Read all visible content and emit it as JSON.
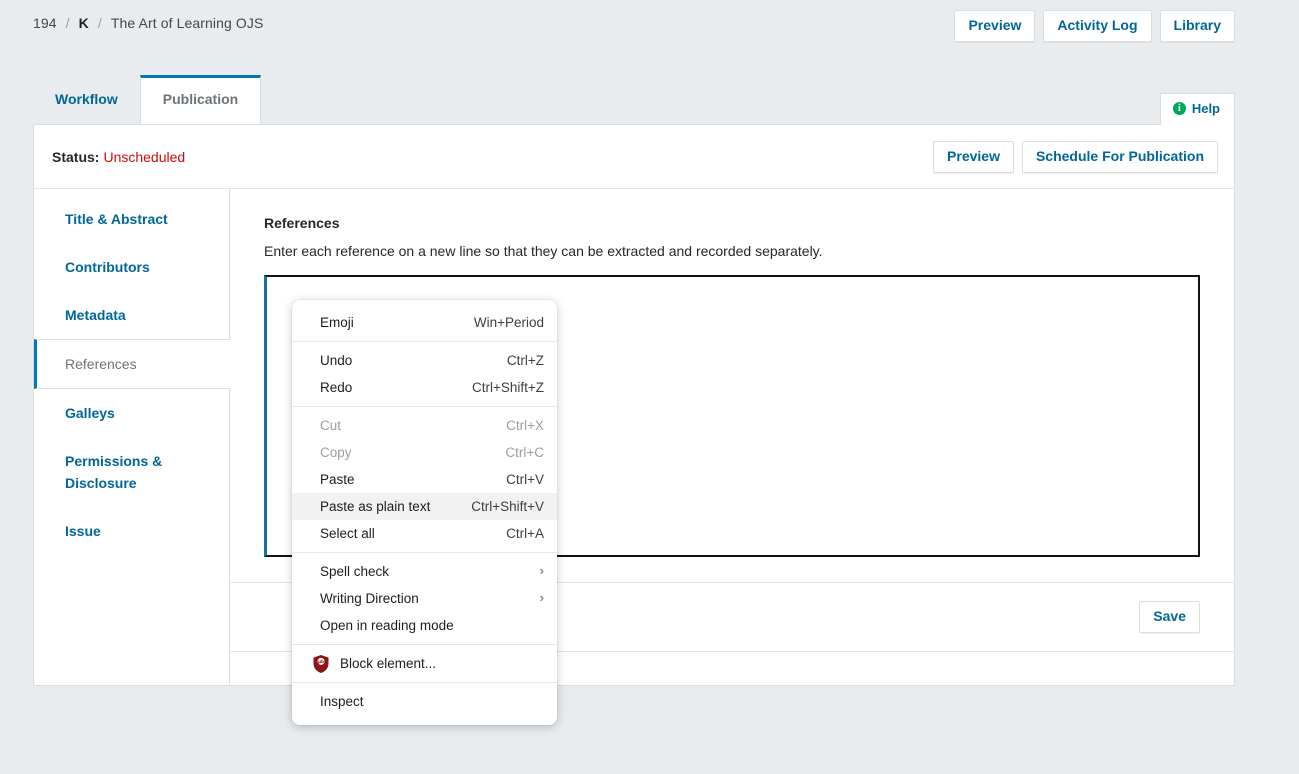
{
  "breadcrumb": {
    "items": [
      {
        "label": "194",
        "bold": false
      },
      {
        "label": "K",
        "bold": true
      },
      {
        "label": "The Art of Learning OJS",
        "bold": false
      }
    ],
    "separator": "/"
  },
  "header_buttons": [
    {
      "label": "Preview"
    },
    {
      "label": "Activity Log"
    },
    {
      "label": "Library"
    }
  ],
  "tabs": [
    {
      "label": "Workflow",
      "active": false
    },
    {
      "label": "Publication",
      "active": true
    }
  ],
  "help": {
    "label": "Help",
    "icon": "info-icon",
    "icon_glyph": "i"
  },
  "status": {
    "label": "Status:",
    "value": "Unscheduled",
    "value_color": "#d00a0a"
  },
  "status_buttons": [
    {
      "label": "Preview"
    },
    {
      "label": "Schedule For Publication"
    }
  ],
  "sidebar": {
    "items": [
      {
        "label": "Title & Abstract",
        "active": false
      },
      {
        "label": "Contributors",
        "active": false
      },
      {
        "label": "Metadata",
        "active": false
      },
      {
        "label": "References",
        "active": true
      },
      {
        "label": "Galleys",
        "active": false
      },
      {
        "label": "Permissions & Disclosure",
        "active": false
      },
      {
        "label": "Issue",
        "active": false
      }
    ],
    "accent_color": "#007ab2"
  },
  "content": {
    "title": "References",
    "description": "Enter each reference on a new line so that they can be extracted and recorded separately.",
    "textarea_value": "",
    "textarea_placeholder": "",
    "save_label": "Save"
  },
  "context_menu": {
    "groups": [
      {
        "items": [
          {
            "label": "Emoji",
            "accel": "Win+Period",
            "state": "normal",
            "icon": null,
            "submenu": false
          }
        ]
      },
      {
        "items": [
          {
            "label": "Undo",
            "accel": "Ctrl+Z",
            "state": "normal",
            "icon": null,
            "submenu": false
          },
          {
            "label": "Redo",
            "accel": "Ctrl+Shift+Z",
            "state": "normal",
            "icon": null,
            "submenu": false
          }
        ]
      },
      {
        "items": [
          {
            "label": "Cut",
            "accel": "Ctrl+X",
            "state": "disabled",
            "icon": null,
            "submenu": false
          },
          {
            "label": "Copy",
            "accel": "Ctrl+C",
            "state": "disabled",
            "icon": null,
            "submenu": false
          },
          {
            "label": "Paste",
            "accel": "Ctrl+V",
            "state": "normal",
            "icon": null,
            "submenu": false
          },
          {
            "label": "Paste as plain text",
            "accel": "Ctrl+Shift+V",
            "state": "hover",
            "icon": null,
            "submenu": false
          },
          {
            "label": "Select all",
            "accel": "Ctrl+A",
            "state": "normal",
            "icon": null,
            "submenu": false
          }
        ]
      },
      {
        "items": [
          {
            "label": "Spell check",
            "accel": "",
            "state": "normal",
            "icon": null,
            "submenu": true
          },
          {
            "label": "Writing Direction",
            "accel": "",
            "state": "normal",
            "icon": null,
            "submenu": true
          },
          {
            "label": "Open in reading mode",
            "accel": "",
            "state": "normal",
            "icon": null,
            "submenu": false
          }
        ]
      },
      {
        "items": [
          {
            "label": "Block element...",
            "accel": "",
            "state": "normal",
            "icon": "ublock-shield-icon",
            "submenu": false
          }
        ]
      },
      {
        "items": [
          {
            "label": "Inspect",
            "accel": "",
            "state": "normal",
            "icon": null,
            "submenu": false
          }
        ]
      }
    ],
    "submenu_arrow": "›",
    "shield_color": "#8c1616"
  },
  "colors": {
    "page_background": "#e8ecee",
    "link_blue": "#006798",
    "accent_blue": "#007ab2",
    "green": "#00a65a"
  }
}
